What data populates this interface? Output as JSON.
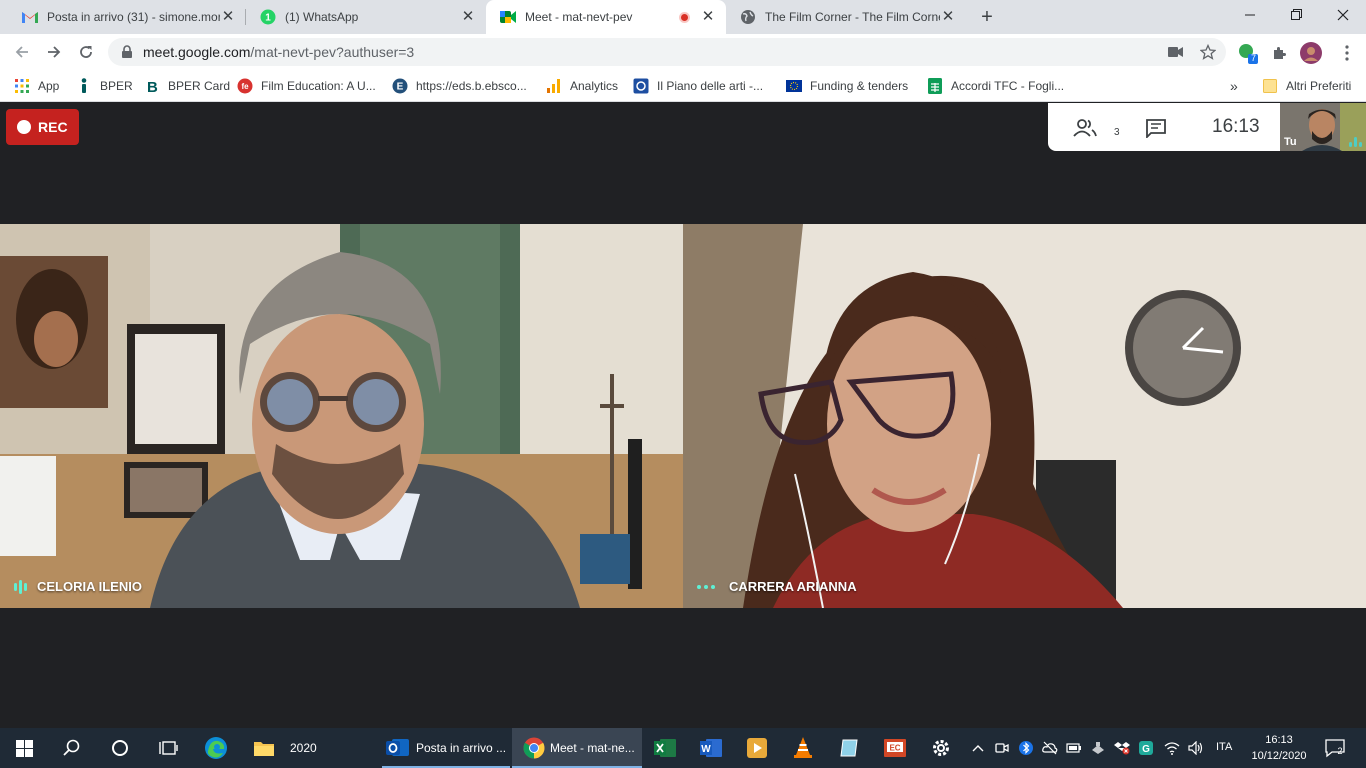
{
  "browser": {
    "tabs": [
      {
        "title": "Posta in arrivo (31) - simone.mor",
        "icon": "gmail-icon"
      },
      {
        "title": "(1) WhatsApp",
        "icon": "whatsapp-icon"
      },
      {
        "title": "Meet - mat-nevt-pev",
        "icon": "meet-icon",
        "active": true,
        "recording": true
      },
      {
        "title": "The Film Corner - The Film Corne",
        "icon": "globe-icon"
      }
    ],
    "url_host": "meet.google.com",
    "url_path": "/mat-nevt-pev?authuser=3",
    "extension_badge": "7",
    "bookmarks": [
      {
        "label": "App",
        "icon": "apps-grid-icon"
      },
      {
        "label": "BPER",
        "icon": "bper-icon"
      },
      {
        "label": "BPER Card",
        "icon": "bper-b-icon"
      },
      {
        "label": "Film Education: A U...",
        "icon": "film-education-icon"
      },
      {
        "label": "https://eds.b.ebsco...",
        "icon": "ebsco-icon"
      },
      {
        "label": "Analytics",
        "icon": "analytics-icon"
      },
      {
        "label": "Il Piano delle arti -...",
        "icon": "piano-arti-icon"
      },
      {
        "label": "Funding & tenders",
        "icon": "eu-flag-icon"
      },
      {
        "label": "Accordi TFC - Fogli...",
        "icon": "sheets-icon"
      }
    ],
    "bookmarks_more": "»",
    "other_bookmarks": "Altri Preferiti"
  },
  "meet": {
    "rec_label": "REC",
    "people_count": "3",
    "time": "16:13",
    "self_label": "Tu",
    "participants": [
      {
        "name": "CELORIA ILENIO"
      },
      {
        "name": "CARRERA ARIANNA"
      }
    ]
  },
  "taskbar": {
    "items": [
      {
        "label": "2020",
        "icon": "folder-icon"
      },
      {
        "label": "Posta in arrivo ...",
        "icon": "outlook-icon"
      },
      {
        "label": "Meet - mat-ne...",
        "icon": "chrome-icon",
        "active": true
      }
    ],
    "lang": "ITA",
    "time": "16:13",
    "date": "10/12/2020",
    "notifications": "2"
  },
  "colors": {
    "meet_bg": "#202124",
    "rec_red": "#c5221f",
    "taskbar_bg": "#1f2a36",
    "speaking_teal": "#5ef0d5"
  }
}
